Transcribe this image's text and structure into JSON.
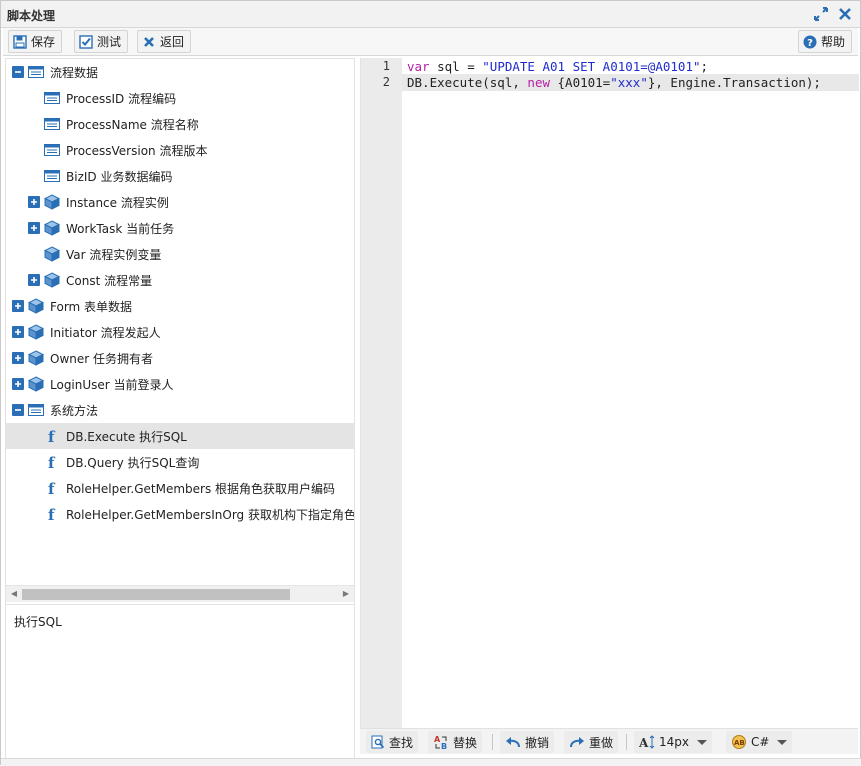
{
  "window": {
    "title": "脚本处理"
  },
  "toolbar": {
    "save_label": "保存",
    "test_label": "测试",
    "back_label": "返回",
    "help_label": "帮助"
  },
  "tree": {
    "nodes": [
      {
        "label": "流程数据",
        "icon": "table-icon",
        "expander": "minus"
      },
      {
        "label": "ProcessID 流程编码",
        "icon": "table-icon",
        "expander": "none"
      },
      {
        "label": "ProcessName 流程名称",
        "icon": "table-icon",
        "expander": "none"
      },
      {
        "label": "ProcessVersion 流程版本",
        "icon": "table-icon",
        "expander": "none"
      },
      {
        "label": "BizID 业务数据编码",
        "icon": "table-icon",
        "expander": "none"
      },
      {
        "label": "Instance 流程实例",
        "icon": "cube-icon",
        "expander": "plus"
      },
      {
        "label": "WorkTask 当前任务",
        "icon": "cube-icon",
        "expander": "plus"
      },
      {
        "label": "Var 流程实例变量",
        "icon": "cube-icon",
        "expander": "none"
      },
      {
        "label": "Const 流程常量",
        "icon": "cube-icon",
        "expander": "plus"
      },
      {
        "label": "Form 表单数据",
        "icon": "cube-icon",
        "expander": "plus"
      },
      {
        "label": "Initiator 流程发起人",
        "icon": "cube-icon",
        "expander": "plus"
      },
      {
        "label": "Owner 任务拥有者",
        "icon": "cube-icon",
        "expander": "plus"
      },
      {
        "label": "LoginUser 当前登录人",
        "icon": "cube-icon",
        "expander": "plus"
      },
      {
        "label": "系统方法",
        "icon": "table-icon",
        "expander": "minus"
      },
      {
        "label": "DB.Execute 执行SQL",
        "icon": "function-icon",
        "expander": "none"
      },
      {
        "label": "DB.Query 执行SQL查询",
        "icon": "function-icon",
        "expander": "none"
      },
      {
        "label": "RoleHelper.GetMembers 根据角色获取用户编码",
        "icon": "function-icon",
        "expander": "none"
      },
      {
        "label": "RoleHelper.GetMembersInOrg 获取机构下指定角色",
        "icon": "function-icon",
        "expander": "none"
      }
    ]
  },
  "description": {
    "text": "执行SQL"
  },
  "editor": {
    "line_numbers": [
      "1",
      "2"
    ],
    "line1": {
      "kw": "var",
      "a": " sql = ",
      "str": "\"UPDATE A01 SET A0101=@A0101\"",
      "b": ";"
    },
    "line2": {
      "a": "DB.Execute(sql, ",
      "kw": "new",
      "b": " {A0101=",
      "str": "\"xxx\"",
      "c": "}, Engine.Transaction);"
    }
  },
  "editor_toolbar": {
    "find_label": "查找",
    "replace_label": "替换",
    "undo_label": "撤销",
    "redo_label": "重做",
    "font_size": "14px",
    "language": "C#"
  },
  "colors": {
    "keyword": "#b41fa3",
    "string": "#1f2ccf",
    "icon_blue": "#2a6fb5",
    "selection": "#e4e4e4"
  }
}
